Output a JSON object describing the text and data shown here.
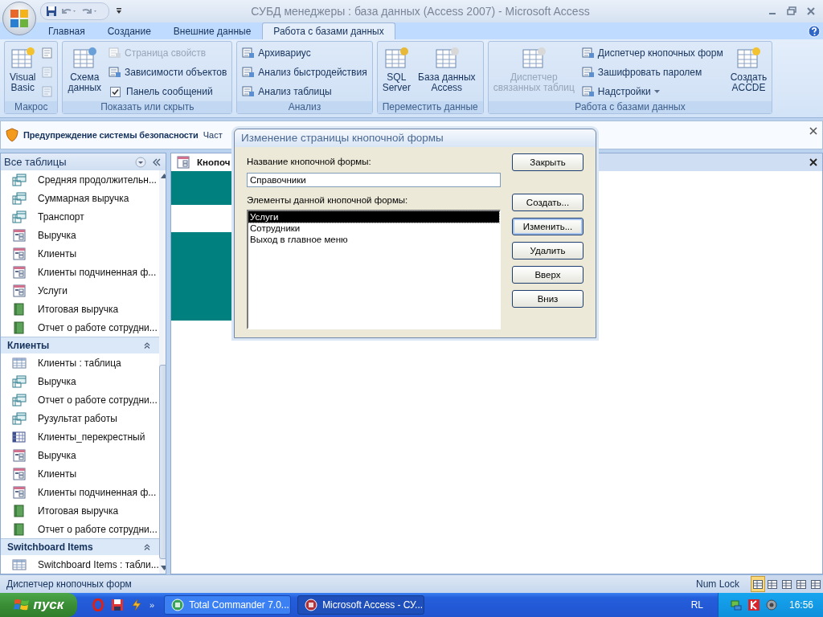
{
  "window": {
    "title": "СУБД менеджеры : база данных (Access 2007)  - Microsoft Access"
  },
  "ribbon_tabs": [
    {
      "label": "Главная",
      "selected": false
    },
    {
      "label": "Создание",
      "selected": false
    },
    {
      "label": "Внешние данные",
      "selected": false
    },
    {
      "label": "Работа с базами данных",
      "selected": true
    }
  ],
  "ribbon_groups": [
    {
      "label": "Макрос",
      "columns": [
        [
          {
            "kind": "large",
            "lines": [
              "Visual",
              "Basic"
            ],
            "disabled": false
          }
        ],
        [
          {
            "kind": "icon",
            "disabled": false
          },
          {
            "kind": "icon",
            "disabled": true
          },
          {
            "kind": "icon",
            "disabled": true
          }
        ]
      ]
    },
    {
      "label": "Показать или скрыть",
      "columns": [
        [
          {
            "kind": "large",
            "lines": [
              "Схема",
              "данных"
            ],
            "disabled": false
          }
        ],
        [
          {
            "kind": "small",
            "label": "Страница свойств",
            "disabled": true
          },
          {
            "kind": "small",
            "label": "Зависимости объектов",
            "disabled": false
          },
          {
            "kind": "check",
            "label": "Панель сообщений",
            "checked": true
          }
        ]
      ]
    },
    {
      "label": "Анализ",
      "columns": [
        [
          {
            "kind": "small",
            "label": "Архивариус",
            "disabled": false
          },
          {
            "kind": "small",
            "label": "Анализ быстродействия",
            "disabled": false
          },
          {
            "kind": "small",
            "label": "Анализ таблицы",
            "disabled": false
          }
        ]
      ]
    },
    {
      "label": "Переместить данные",
      "columns": [
        [
          {
            "kind": "large",
            "lines": [
              "SQL",
              "Server"
            ],
            "disabled": false
          }
        ],
        [
          {
            "kind": "large",
            "lines": [
              "База данных",
              "Access"
            ],
            "disabled": false
          }
        ]
      ]
    },
    {
      "label": "Работа с базами данных",
      "columns": [
        [
          {
            "kind": "large",
            "lines": [
              "Диспетчер",
              "связанных таблиц"
            ],
            "disabled": true
          }
        ],
        [
          {
            "kind": "small",
            "label": "Диспетчер кнопочных форм",
            "disabled": false
          },
          {
            "kind": "small",
            "label": "Зашифровать паролем",
            "disabled": false
          },
          {
            "kind": "dropdown",
            "label": "Надстройки",
            "disabled": false
          }
        ],
        [
          {
            "kind": "large",
            "lines": [
              "Создать",
              "ACCDE"
            ],
            "disabled": false
          }
        ]
      ]
    }
  ],
  "security_bar": {
    "title": "Предупреждение системы безопасности",
    "text": "Част"
  },
  "nav_pane": {
    "header": "Все таблицы",
    "sections": [
      {
        "items": [
          {
            "kind": "query",
            "label": "Средняя продолжительн..."
          },
          {
            "kind": "query",
            "label": "Суммарная выручка"
          },
          {
            "kind": "query",
            "label": "Транспорт"
          },
          {
            "kind": "form",
            "label": "Выручка"
          },
          {
            "kind": "form",
            "label": "Клиенты"
          },
          {
            "kind": "form",
            "label": "Клиенты подчиненная ф..."
          },
          {
            "kind": "form",
            "label": "Услуги"
          },
          {
            "kind": "report",
            "label": "Итоговая выручка"
          },
          {
            "kind": "report",
            "label": "Отчет о работе сотрудни..."
          }
        ]
      },
      {
        "title": "Клиенты",
        "expanded": true,
        "items": [
          {
            "kind": "table",
            "label": "Клиенты : таблица"
          },
          {
            "kind": "query",
            "label": "Выручка"
          },
          {
            "kind": "query",
            "label": "Отчет о работе сотрудни..."
          },
          {
            "kind": "query",
            "label": "Рузультат работы"
          },
          {
            "kind": "crosstab",
            "label": "Клиенты_перекрестный"
          },
          {
            "kind": "form",
            "label": "Выручка"
          },
          {
            "kind": "form",
            "label": "Клиенты"
          },
          {
            "kind": "form",
            "label": "Клиенты подчиненная ф..."
          },
          {
            "kind": "report",
            "label": "Итоговая выручка"
          },
          {
            "kind": "report",
            "label": "Отчет о работе сотрудни..."
          }
        ]
      },
      {
        "title": "Switchboard Items",
        "expanded": true,
        "items": [
          {
            "kind": "table",
            "label": "Switchboard Items : табли..."
          }
        ]
      }
    ]
  },
  "document_tab": {
    "label": "Кнопоч"
  },
  "dialog": {
    "title": "Изменение страницы кнопочной формы",
    "name_label": "Название кнопочной формы:",
    "name_value": "Справочники",
    "items_label": "Элементы данной кнопочной формы:",
    "items": [
      {
        "label": "Услуги",
        "selected": true
      },
      {
        "label": "Сотрудники",
        "selected": false
      },
      {
        "label": "Выход в главное меню",
        "selected": false
      }
    ],
    "buttons": [
      {
        "label": "Закрыть",
        "focused": false
      },
      {
        "label": "Создать...",
        "focused": false
      },
      {
        "label": "Изменить...",
        "focused": true
      },
      {
        "label": "Удалить",
        "focused": false
      },
      {
        "label": "Вверх",
        "focused": false
      },
      {
        "label": "Вниз",
        "focused": false
      }
    ]
  },
  "status_bar": {
    "text": "Диспетчер кнопочных форм",
    "indicator": "Num Lock",
    "views": [
      {
        "selected": true
      },
      {
        "selected": false
      },
      {
        "selected": false
      },
      {
        "selected": false
      },
      {
        "selected": false
      }
    ]
  },
  "taskbar": {
    "start": "пуск",
    "more": "»",
    "tasks": [
      {
        "label": "Total Commander 7.0...",
        "selected": false
      },
      {
        "label": "Microsoft Access - СУ...",
        "selected": true
      }
    ],
    "language": "RL",
    "time": "16:56"
  }
}
